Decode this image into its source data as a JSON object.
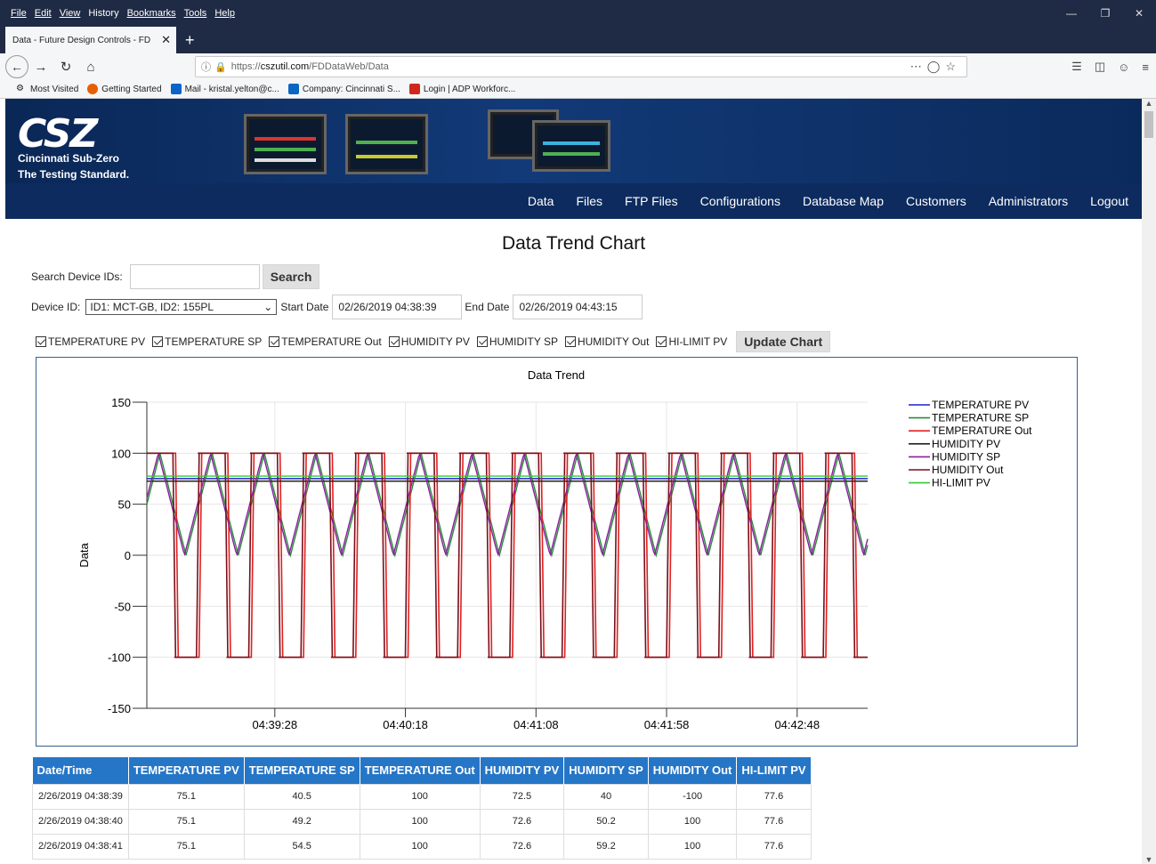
{
  "browser": {
    "menu": [
      "File",
      "Edit",
      "View",
      "History",
      "Bookmarks",
      "Tools",
      "Help"
    ],
    "tab_title": "Data - Future Design Controls - FD",
    "url_proto": "https://",
    "url_host": "cszutil.com",
    "url_path": "/FDDataWeb/Data",
    "bookmarks": [
      "Most Visited",
      "Getting Started",
      "Mail - kristal.yelton@c...",
      "Company: Cincinnati S...",
      "Login | ADP Workforc..."
    ]
  },
  "site": {
    "logo_mark": "CSZ",
    "logo_line1": "Cincinnati Sub-Zero",
    "logo_line2": "The Testing Standard.",
    "nav": [
      "Data",
      "Files",
      "FTP Files",
      "Configurations",
      "Database Map",
      "Customers",
      "Administrators",
      "Logout"
    ]
  },
  "page": {
    "title": "Data Trend Chart",
    "search_label": "Search Device IDs:",
    "search_value": "",
    "search_button": "Search",
    "device_label": "Device ID:",
    "device_value": "ID1: MCT-GB, ID2: 155PL",
    "start_label": "Start Date",
    "start_value": "02/26/2019 04:38:39",
    "end_label": "End Date",
    "end_value": "02/26/2019 04:43:15",
    "checkboxes": [
      "TEMPERATURE PV",
      "TEMPERATURE SP",
      "TEMPERATURE Out",
      "HUMIDITY PV",
      "HUMIDITY SP",
      "HUMIDITY Out",
      "HI-LIMIT PV"
    ],
    "update_button": "Update Chart"
  },
  "chart_data": {
    "type": "line",
    "title": "Data Trend",
    "ylabel": "Data",
    "xlabel": "",
    "ylim": [
      -150,
      150
    ],
    "yticks": [
      150,
      100,
      50,
      0,
      -50,
      -100,
      -150
    ],
    "x_tick_labels": [
      "04:39:28",
      "04:40:18",
      "04:41:08",
      "04:41:58",
      "04:42:48"
    ],
    "x_tick_seconds": [
      49,
      99,
      149,
      199,
      249
    ],
    "x_range_seconds": [
      0,
      276
    ],
    "grid": true,
    "legend_position": "right",
    "period_seconds": 20,
    "series": [
      {
        "name": "TEMPERATURE PV",
        "color": "#1f1fd6",
        "kind": "constant",
        "value": 75.1
      },
      {
        "name": "TEMPERATURE SP",
        "color": "#2a8a3a",
        "kind": "triangle"
      },
      {
        "name": "TEMPERATURE Out",
        "color": "#e02020",
        "kind": "square"
      },
      {
        "name": "HUMIDITY PV",
        "color": "#222222",
        "kind": "constant",
        "value": 72.6
      },
      {
        "name": "HUMIDITY SP",
        "color": "#8a1fa0",
        "kind": "triangle"
      },
      {
        "name": "HUMIDITY Out",
        "color": "#7a0f1a",
        "kind": "square"
      },
      {
        "name": "HI-LIMIT PV",
        "color": "#33cc33",
        "kind": "constant",
        "value": 77.6
      }
    ]
  },
  "table": {
    "headers": [
      "Date/Time",
      "TEMPERATURE PV",
      "TEMPERATURE SP",
      "TEMPERATURE Out",
      "HUMIDITY PV",
      "HUMIDITY SP",
      "HUMIDITY Out",
      "HI-LIMIT PV"
    ],
    "rows": [
      [
        "2/26/2019 04:38:39",
        "75.1",
        "40.5",
        "100",
        "72.5",
        "40",
        "-100",
        "77.6"
      ],
      [
        "2/26/2019 04:38:40",
        "75.1",
        "49.2",
        "100",
        "72.6",
        "50.2",
        "100",
        "77.6"
      ],
      [
        "2/26/2019 04:38:41",
        "75.1",
        "54.5",
        "100",
        "72.6",
        "59.2",
        "100",
        "77.6"
      ]
    ]
  }
}
